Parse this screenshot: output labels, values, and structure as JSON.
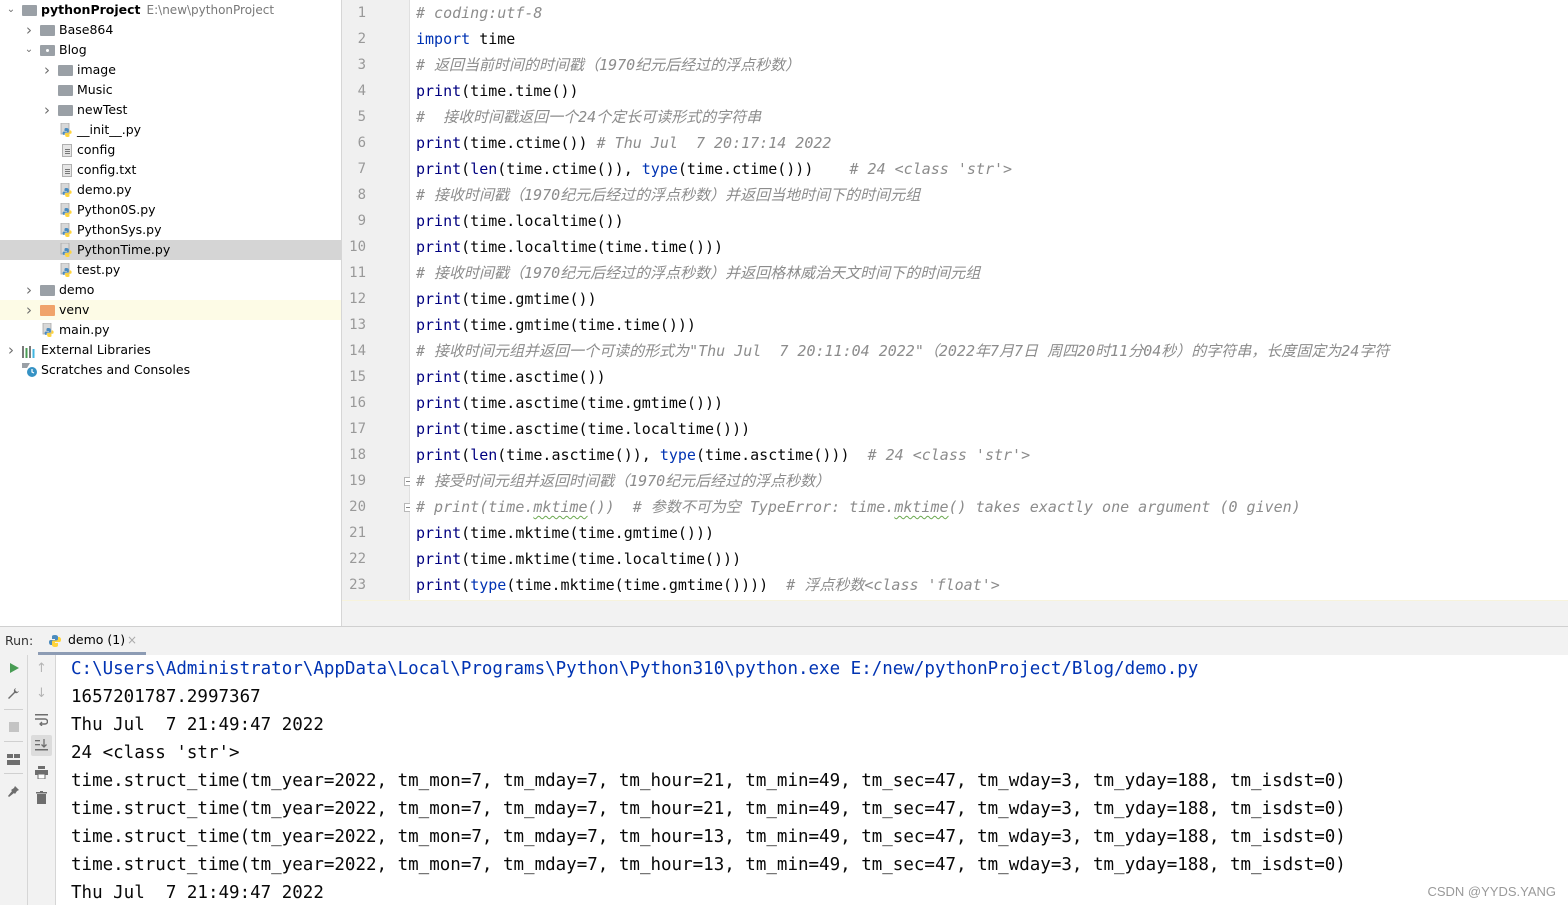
{
  "project_tree": {
    "root": {
      "label": "pythonProject",
      "path": "E:\\new\\pythonProject"
    },
    "items": [
      {
        "label": "Base864",
        "type": "folder",
        "level": 1,
        "expanded": false
      },
      {
        "label": "Blog",
        "type": "package",
        "level": 1,
        "expanded": true
      },
      {
        "label": "image",
        "type": "folder",
        "level": 2,
        "expanded": false
      },
      {
        "label": "Music",
        "type": "folder",
        "level": 2
      },
      {
        "label": "newTest",
        "type": "folder",
        "level": 2,
        "expanded": false
      },
      {
        "label": "__init__.py",
        "type": "python",
        "level": 2
      },
      {
        "label": "config",
        "type": "text",
        "level": 2
      },
      {
        "label": "config.txt",
        "type": "text",
        "level": 2
      },
      {
        "label": "demo.py",
        "type": "python",
        "level": 2
      },
      {
        "label": "Python0S.py",
        "type": "python",
        "level": 2
      },
      {
        "label": "PythonSys.py",
        "type": "python",
        "level": 2
      },
      {
        "label": "PythonTime.py",
        "type": "python",
        "level": 2,
        "selected": true
      },
      {
        "label": "test.py",
        "type": "python",
        "level": 2
      },
      {
        "label": "demo",
        "type": "folder",
        "level": 1,
        "expanded": false
      },
      {
        "label": "venv",
        "type": "venv-folder",
        "level": 1,
        "expanded": false
      },
      {
        "label": "main.py",
        "type": "python",
        "level": 1
      },
      {
        "label": "External Libraries",
        "type": "libraries",
        "level": 0,
        "expanded": false
      },
      {
        "label": "Scratches and Consoles",
        "type": "scratches",
        "level": 0
      }
    ]
  },
  "editor": {
    "file": "PythonTime.py",
    "lines": [
      [
        {
          "t": "# coding:utf-8",
          "c": "cm"
        }
      ],
      [
        {
          "t": "import",
          "c": "kw"
        },
        {
          "t": " time"
        }
      ],
      [
        {
          "t": "# 返回当前时间的时间戳（1970纪元后经过的浮点秒数）",
          "c": "cm"
        }
      ],
      [
        {
          "t": "print",
          "c": "bi"
        },
        {
          "t": "(time.time())"
        }
      ],
      [
        {
          "t": "#  接收时间戳返回一个24个定长可读形式的字符串",
          "c": "cm"
        }
      ],
      [
        {
          "t": "print",
          "c": "bi"
        },
        {
          "t": "(time.ctime()) "
        },
        {
          "t": "# Thu Jul  7 20:17:14 2022",
          "c": "cm"
        }
      ],
      [
        {
          "t": "print",
          "c": "bi"
        },
        {
          "t": "("
        },
        {
          "t": "len",
          "c": "bi"
        },
        {
          "t": "(time.ctime()), "
        },
        {
          "t": "type",
          "c": "kw"
        },
        {
          "t": "(time.ctime()))    "
        },
        {
          "t": "# 24 <class 'str'>",
          "c": "cm"
        }
      ],
      [
        {
          "t": "# 接收时间戳（1970纪元后经过的浮点秒数）并返回当地时间下的时间元组",
          "c": "cm"
        }
      ],
      [
        {
          "t": "print",
          "c": "bi"
        },
        {
          "t": "(time.localtime())"
        }
      ],
      [
        {
          "t": "print",
          "c": "bi"
        },
        {
          "t": "(time.localtime(time.time()))"
        }
      ],
      [
        {
          "t": "# 接收时间戳（1970纪元后经过的浮点秒数）并返回格林威治天文时间下的时间元组",
          "c": "cm"
        }
      ],
      [
        {
          "t": "print",
          "c": "bi"
        },
        {
          "t": "(time.gmtime())"
        }
      ],
      [
        {
          "t": "print",
          "c": "bi"
        },
        {
          "t": "(time.gmtime(time.time()))"
        }
      ],
      [
        {
          "t": "# 接收时间元组并返回一个可读的形式为\"Thu Jul  7 20:11:04 2022\"（2022年7月7日 周四20时11分04秒）的字符串，长度固定为24字符",
          "c": "cm"
        }
      ],
      [
        {
          "t": "print",
          "c": "bi"
        },
        {
          "t": "(time.asctime())"
        }
      ],
      [
        {
          "t": "print",
          "c": "bi"
        },
        {
          "t": "(time.asctime(time.gmtime()))"
        }
      ],
      [
        {
          "t": "print",
          "c": "bi"
        },
        {
          "t": "(time.asctime(time.localtime()))"
        }
      ],
      [
        {
          "t": "print",
          "c": "bi"
        },
        {
          "t": "("
        },
        {
          "t": "len",
          "c": "bi"
        },
        {
          "t": "(time.asctime()), "
        },
        {
          "t": "type",
          "c": "kw"
        },
        {
          "t": "(time.asctime()))  "
        },
        {
          "t": "# 24 <class 'str'>",
          "c": "cm"
        }
      ],
      [
        {
          "t": "# 接受时间元组并返回时间戳（1970纪元后经过的浮点秒数）",
          "c": "cm"
        }
      ],
      [
        {
          "t": "# print(time.",
          "c": "cm"
        },
        {
          "t": "mktime",
          "c": "cm squiggle"
        },
        {
          "t": "())  # 参数不可为空 TypeError: time.",
          "c": "cm"
        },
        {
          "t": "mktime",
          "c": "cm squiggle"
        },
        {
          "t": "() takes exactly one argument (0 given)",
          "c": "cm"
        }
      ],
      [
        {
          "t": "print",
          "c": "bi"
        },
        {
          "t": "(time.mktime(time.gmtime()))"
        }
      ],
      [
        {
          "t": "print",
          "c": "bi"
        },
        {
          "t": "(time.mktime(time.localtime()))"
        }
      ],
      [
        {
          "t": "print",
          "c": "bi"
        },
        {
          "t": "("
        },
        {
          "t": "type",
          "c": "kw"
        },
        {
          "t": "(time.mktime(time.gmtime())))  "
        },
        {
          "t": "# 浮点秒数<class 'float'>",
          "c": "cm"
        }
      ]
    ],
    "fold_markers_at_lines": [
      19,
      20
    ]
  },
  "run_panel": {
    "label": "Run:",
    "tab": {
      "label": "demo (1)",
      "close": "×"
    },
    "toolbar_left": [
      "run-icon",
      "wrench-icon",
      "stop-icon",
      "layout-icon",
      "pin-icon"
    ],
    "toolbar_right": [
      "up-arrow-icon",
      "down-arrow-icon",
      "soft-wrap-icon",
      "scroll-to-end-icon",
      "print-icon",
      "trash-icon"
    ],
    "output": [
      {
        "text": "C:\\Users\\Administrator\\AppData\\Local\\Programs\\Python\\Python310\\python.exe E:/new/pythonProject/Blog/demo.py",
        "kind": "cmd"
      },
      {
        "text": "1657201787.2997367"
      },
      {
        "text": "Thu Jul  7 21:49:47 2022"
      },
      {
        "text": "24 <class 'str'>"
      },
      {
        "text": "time.struct_time(tm_year=2022, tm_mon=7, tm_mday=7, tm_hour=21, tm_min=49, tm_sec=47, tm_wday=3, tm_yday=188, tm_isdst=0)"
      },
      {
        "text": "time.struct_time(tm_year=2022, tm_mon=7, tm_mday=7, tm_hour=21, tm_min=49, tm_sec=47, tm_wday=3, tm_yday=188, tm_isdst=0)"
      },
      {
        "text": "time.struct_time(tm_year=2022, tm_mon=7, tm_mday=7, tm_hour=13, tm_min=49, tm_sec=47, tm_wday=3, tm_yday=188, tm_isdst=0)"
      },
      {
        "text": "time.struct_time(tm_year=2022, tm_mon=7, tm_mday=7, tm_hour=13, tm_min=49, tm_sec=47, tm_wday=3, tm_yday=188, tm_isdst=0)"
      },
      {
        "text": "Thu Jul  7 21:49:47 2022"
      }
    ]
  },
  "watermark": "CSDN @YYDS.YANG"
}
